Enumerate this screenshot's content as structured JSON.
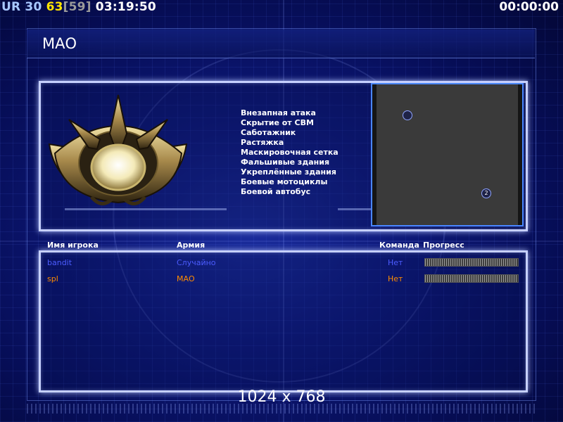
{
  "hud": {
    "prefix": "UR",
    "number_a": "30",
    "number_b": "63",
    "number_c": "[59]",
    "clock": "03:19:50",
    "timer": "00:00:00"
  },
  "title": "МАО",
  "upgrades": [
    "Внезапная атака",
    "Скрытие от СВМ",
    "Саботажник",
    "Растяжка",
    "Маскировочная сетка",
    "Фальшивые здания",
    "Укреплённые здания",
    "Боевые мотоциклы",
    "Боевой автобус"
  ],
  "map": {
    "start_positions": [
      {
        "label": ""
      },
      {
        "label": "2"
      }
    ]
  },
  "columns": {
    "player": "Имя игрока",
    "army": "Армия",
    "team": "Команда",
    "progress": "Прогресс"
  },
  "players": [
    {
      "name": "bandit",
      "army": "Случайно",
      "team": "Нет",
      "color": "#4c5cff",
      "progress": 1.0
    },
    {
      "name": "spl",
      "army": "МАО",
      "team": "Нет",
      "color": "#ff8c00",
      "progress": 1.0
    }
  ],
  "resolution": "1024 x 768",
  "colors": {
    "accent": "#c6d0ff",
    "hud_yellow": "#ffe400",
    "hud_blue": "#a8c8ff",
    "background": "#0d1878"
  }
}
